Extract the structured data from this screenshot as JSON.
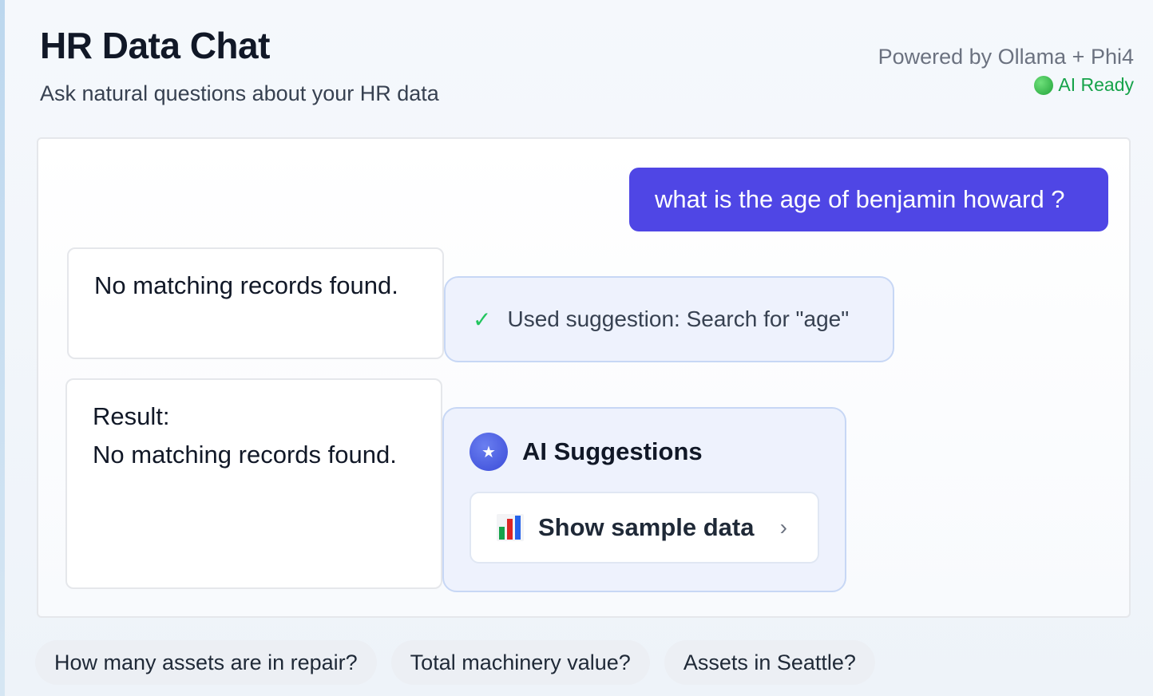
{
  "header": {
    "title": "HR Data Chat",
    "subtitle": "Ask natural questions about your HR data",
    "powered_by": "Powered by Ollama + Phi4",
    "status": "AI Ready"
  },
  "chat": {
    "user_message": "what is the age of benjamin howard ?",
    "bot_response_1": "No matching records found.",
    "used_suggestion": "Used suggestion: Search for \"age\"",
    "bot_response_2_label": "Result:",
    "bot_response_2_text": "No matching records found.",
    "ai_suggestions": {
      "title": "AI Suggestions",
      "items": [
        {
          "label": "Show sample data",
          "icon": "bar-chart-icon"
        }
      ]
    }
  },
  "quick_questions": [
    "How many assets are in repair?",
    "Total machinery value?",
    "Assets in Seattle?"
  ],
  "colors": {
    "accent": "#4f46e5",
    "status_green": "#16a34a"
  }
}
